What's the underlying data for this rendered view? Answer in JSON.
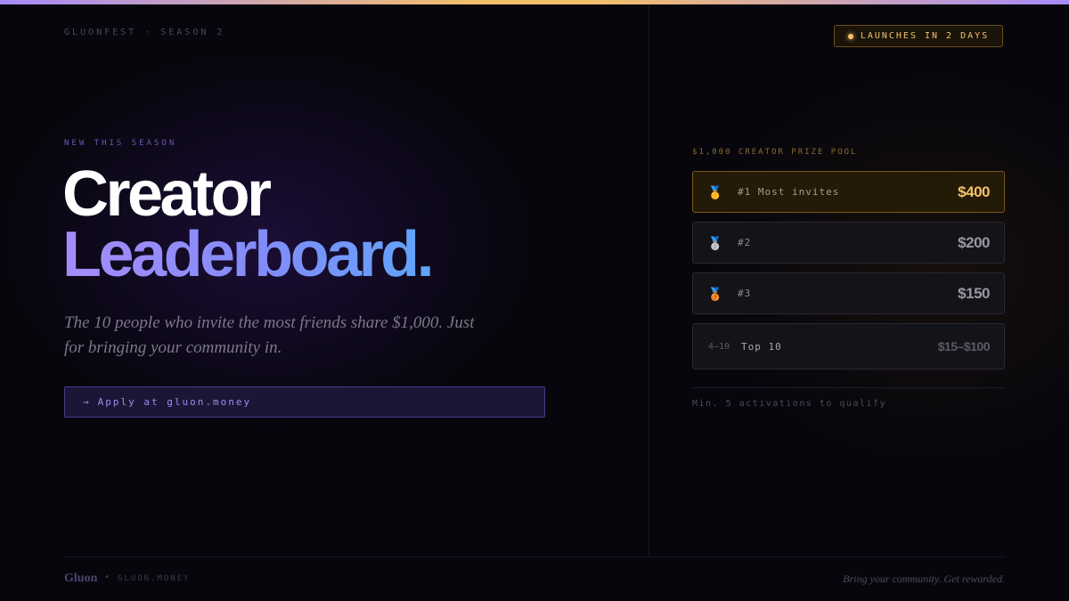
{
  "header": {
    "brand": "GLUONFEST · SEASON 2",
    "badge": "LAUNCHES IN 2 DAYS"
  },
  "hero": {
    "eyebrow": "NEW THIS SEASON",
    "title_line1": "Creator",
    "title_line2": "Leaderboard.",
    "description": "The 10 people who invite the most friends share $1,000. Just for bringing your community in.",
    "cta_arrow": "→",
    "cta_label": "Apply at gluon.money"
  },
  "prize_pool": {
    "label": "$1,000 CREATOR PRIZE POOL",
    "tiers": [
      {
        "icon": "gold-medal-icon",
        "medal": "🥇",
        "label": "#1 Most invites",
        "amount": "$400"
      },
      {
        "icon": "silver-medal-icon",
        "medal": "🥈",
        "label": "#2",
        "amount": "$200"
      },
      {
        "icon": "bronze-medal-icon",
        "medal": "🥉",
        "label": "#3",
        "amount": "$150"
      },
      {
        "range": "4–10",
        "label": "Top 10",
        "amount": "$15–$100"
      }
    ],
    "qualify_note": "Min. 5 activations to qualify"
  },
  "footer": {
    "brand": "Gluon",
    "separator": "•",
    "url": "GLUON.MONEY",
    "tagline": "Bring your community. Get rewarded."
  },
  "colors": {
    "accent_purple": "#a78bfa",
    "accent_blue": "#60a5fa",
    "accent_gold": "#f5c06a",
    "background": "#07060d"
  }
}
